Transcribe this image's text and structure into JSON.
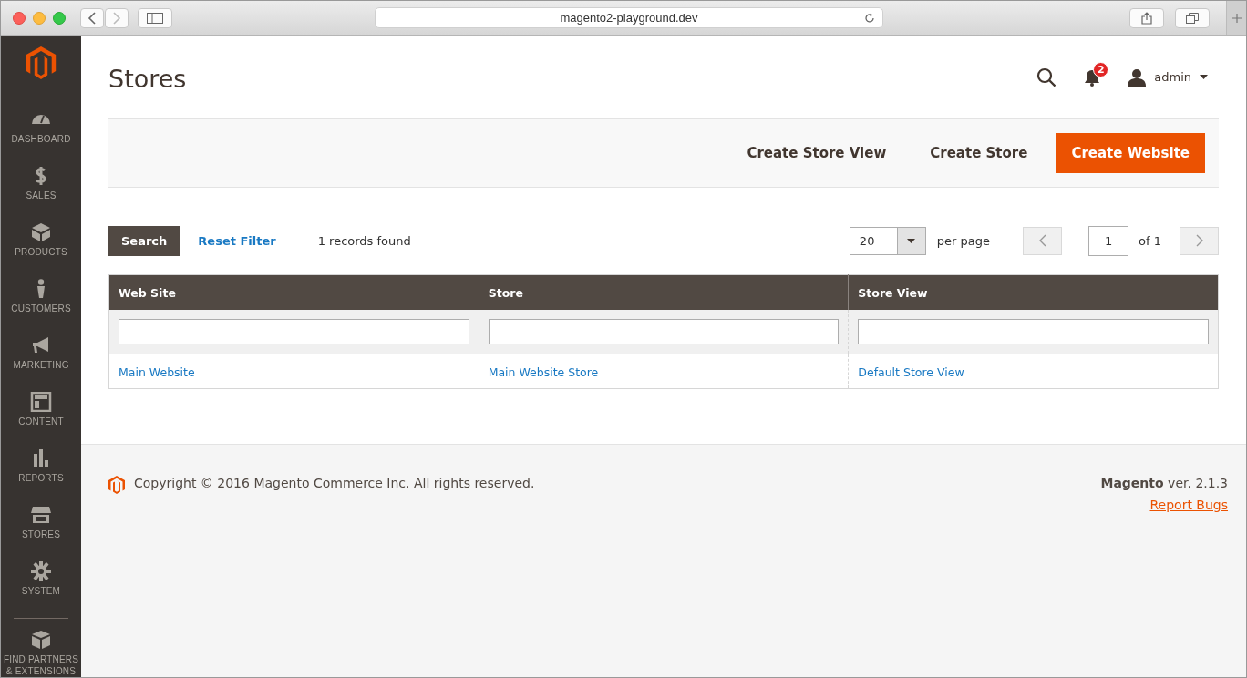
{
  "browser": {
    "url": "magento2-playground.dev"
  },
  "sidebar": {
    "items": [
      {
        "label": "DASHBOARD"
      },
      {
        "label": "SALES"
      },
      {
        "label": "PRODUCTS"
      },
      {
        "label": "CUSTOMERS"
      },
      {
        "label": "MARKETING"
      },
      {
        "label": "CONTENT"
      },
      {
        "label": "REPORTS"
      },
      {
        "label": "STORES"
      },
      {
        "label": "SYSTEM"
      },
      {
        "label": "FIND PARTNERS & EXTENSIONS"
      }
    ]
  },
  "header": {
    "title": "Stores",
    "notifications": "2",
    "user": "admin"
  },
  "actions": [
    "Create Store View",
    "Create Store",
    "Create Website"
  ],
  "toolbar": {
    "search": "Search",
    "reset": "Reset Filter",
    "records": "1 records found",
    "per_page_value": "20",
    "per_page_label": "per page",
    "page_value": "1",
    "page_total": "of 1"
  },
  "table": {
    "columns": [
      "Web Site",
      "Store",
      "Store View"
    ],
    "rows": [
      [
        "Main Website",
        "Main Website Store",
        "Default Store View"
      ]
    ]
  },
  "footer": {
    "copyright": "Copyright © 2016 Magento Commerce Inc. All rights reserved.",
    "version": "**Magento** ver. 2.1.3",
    "report": "Report Bugs"
  }
}
